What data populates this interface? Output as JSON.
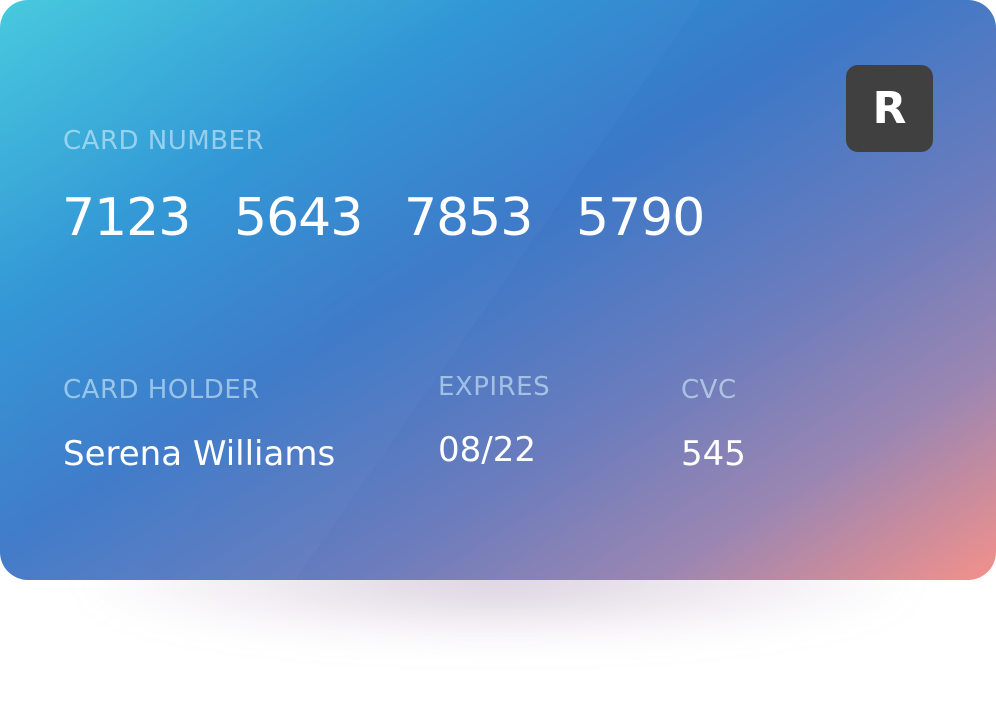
{
  "card": {
    "brand_letter": "R",
    "number_label": "CARD NUMBER",
    "number_groups": [
      "7123",
      "5643",
      "7853",
      "5790"
    ],
    "holder_label": "CARD HOLDER",
    "holder_name": "Serena Williams",
    "expires_label": "EXPIRES",
    "expires_value": "08/22",
    "cvc_label": "CVC",
    "cvc_value": "545"
  },
  "colors": {
    "gradient_start": "#3ec7dc",
    "gradient_mid": "#3a78c8",
    "gradient_end": "#f4918a",
    "brand_badge": "#404040"
  },
  "icons": {
    "brand": "brand-logo-r"
  }
}
